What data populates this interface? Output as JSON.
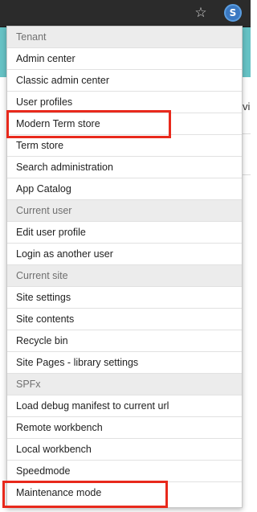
{
  "browser": {
    "bookmark_icon": "star-icon",
    "extension_icon": "sharepoint-extension-icon",
    "extension_letter": "S",
    "extension_color": "#3a78c2"
  },
  "background": {
    "partial_text": "vi",
    "accent_color": "#66c2c5"
  },
  "menu": {
    "sections": [
      {
        "header": "Tenant",
        "items": [
          "Admin center",
          "Classic admin center",
          "User profiles",
          "Modern Term store",
          "Term store",
          "Search administration",
          "App Catalog"
        ]
      },
      {
        "header": "Current user",
        "items": [
          "Edit user profile",
          "Login as another user"
        ]
      },
      {
        "header": "Current site",
        "items": [
          "Site settings",
          "Site contents",
          "Recycle bin",
          "Site Pages - library settings"
        ]
      },
      {
        "header": "SPFx",
        "items": [
          "Load debug manifest to current url",
          "Remote workbench",
          "Local workbench",
          "Speedmode",
          "Maintenance mode"
        ]
      }
    ]
  },
  "highlights": {
    "color": "#e8291c",
    "items": [
      "Modern Term store",
      "Maintenance mode"
    ]
  }
}
